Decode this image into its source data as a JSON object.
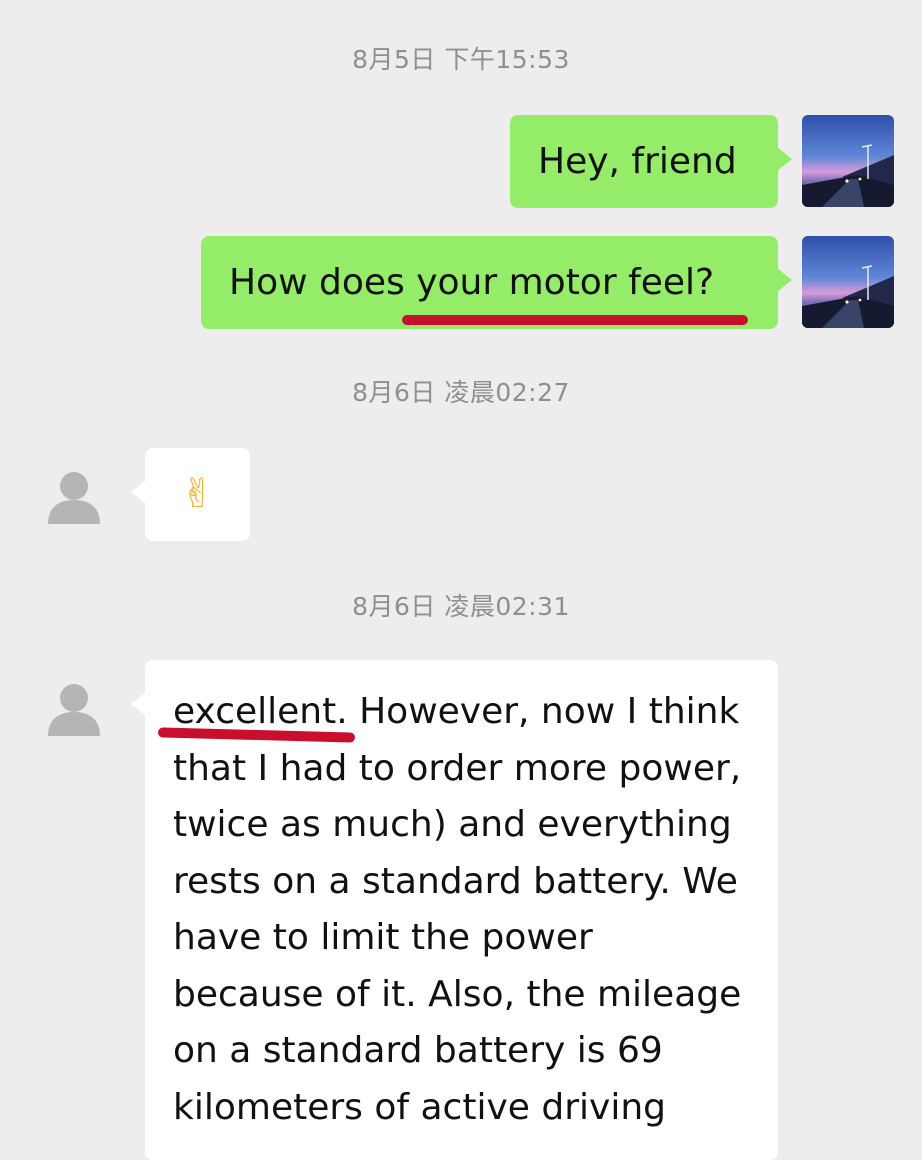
{
  "timestamps": [
    "8月5日 下午15:53",
    "8月6日 凌晨02:27",
    "8月6日 凌晨02:31"
  ],
  "messages": {
    "m1": "Hey, friend",
    "m2": "How does your motor feel?",
    "m3_emoji": "✌",
    "m4_lines": [
      "excellent. However, now I think",
      "that I had to order more power,",
      "twice as much) and everything",
      "rests on a standard battery. We",
      "have to limit the power",
      "because of it. Also, the mileage",
      "on a standard battery is 69",
      "kilometers of active driving"
    ]
  },
  "colors": {
    "background": "#ededed",
    "my_bubble": "#95ec69",
    "other_bubble": "#ffffff",
    "timestamp": "#8f8f8f",
    "annotation_underline": "#c8102e"
  },
  "icons": {
    "my_avatar": "sunset-road-photo-avatar",
    "other_avatar": "default-person-avatar"
  }
}
